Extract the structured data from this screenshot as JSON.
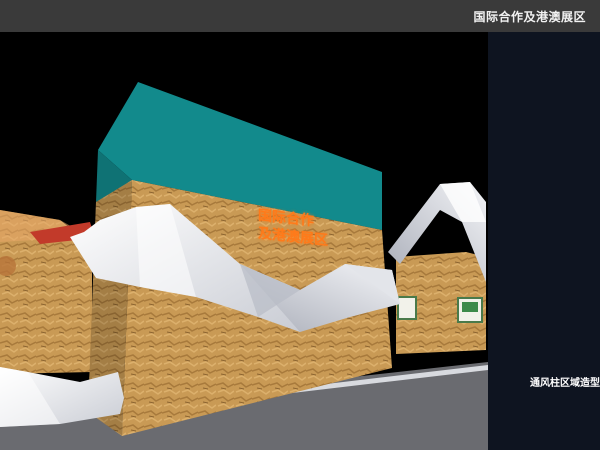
{
  "header": {
    "title": "国际合作及港澳展区"
  },
  "booth": {
    "sign_line1": "国际合作",
    "sign_line2": "及港澳展区"
  },
  "side_panel": {
    "caption": "通风柱区域造型"
  },
  "colors": {
    "top_bar": "#3a3a3a",
    "side_panel": "#0e1420",
    "teal_roof": "#128a8c",
    "osb_wood": "#c99a55",
    "white_band": "#eef0f4",
    "sign_orange": "#ff7a1a"
  }
}
